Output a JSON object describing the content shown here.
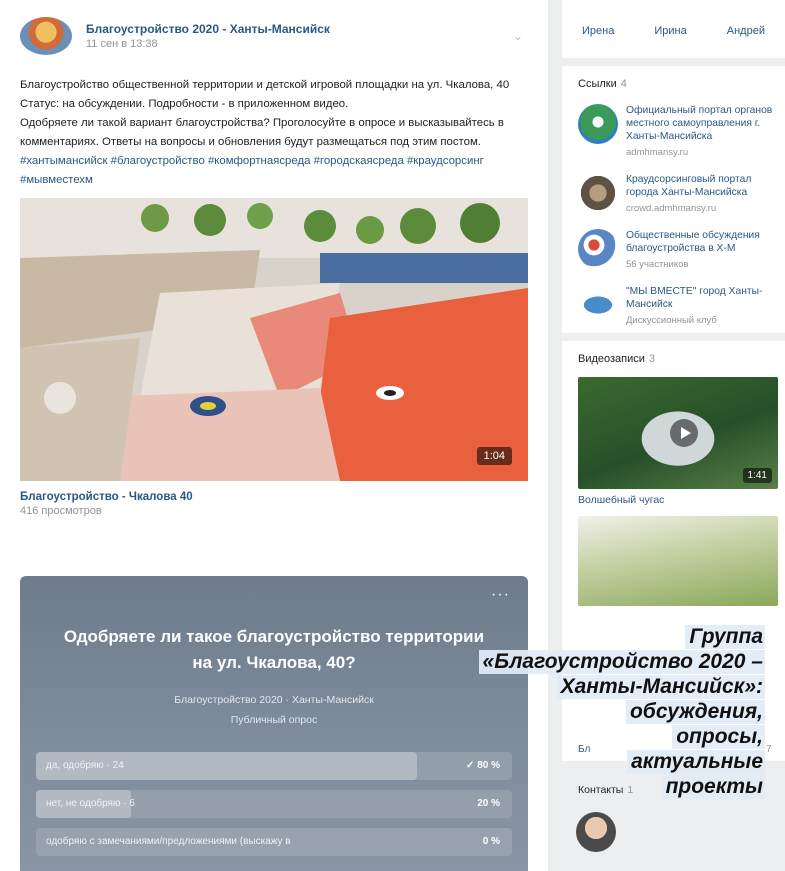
{
  "post": {
    "group_name": "Благоустройство 2020 - Ханты-Мансийск",
    "date": "11 сен в 13:38",
    "text_lines": [
      "Благоустройство общественной территории и детской игровой площадки на ул. Чкалова, 40",
      "Статус: на обсуждении. Подробности - в приложенном видео.",
      "Одобряете ли такой вариант благоустройства? Проголосуйте в опросе и высказывайтесь в комментариях. Ответы на вопросы и обновления будут размещаться под этим постом."
    ],
    "hashtags": "#хантымансийск #благоустройство #комфортнаясреда #городскаясреда #краудсорсинг #мывместехм",
    "video": {
      "duration": "1:04",
      "title": "Благоустройство - Чкалова 40",
      "views": "416 просмотров"
    },
    "poll": {
      "more": "···",
      "question": "Одобряете ли такое благоустройство территории на ул. Чкалова, 40?",
      "author": "Благоустройство 2020 · Ханты-Мансийск",
      "type": "Публичный опрос",
      "options": [
        {
          "label": "да, одобряю · 24",
          "percent": "80 %",
          "fraction": 0.8,
          "voted": true,
          "check": "✓"
        },
        {
          "label": "нет, не одобряю · 6",
          "percent": "20 %",
          "fraction": 0.2,
          "voted": false,
          "check": ""
        },
        {
          "label": "одобряю с замечаниями/предложениями (выскажу в",
          "percent": "0 %",
          "fraction": 0.0,
          "voted": false,
          "check": ""
        }
      ]
    }
  },
  "sidebar": {
    "friends": [
      "Ирена",
      "Ирина",
      "Андрей"
    ],
    "links": {
      "header": "Ссылки",
      "count": "4",
      "items": [
        {
          "title": "Официальный портал органов местного самоуправления г. Ханты-Мансийска",
          "sub": "admhmansy.ru",
          "color": "#3a9a5a"
        },
        {
          "title": "Краудсорсинговый портал города Ханты-Мансийска",
          "sub": "crowd.admhmansy.ru",
          "color": "#7a6a55"
        },
        {
          "title": "Общественные обсуждения благоустройства в Х-М",
          "sub": "56 участников",
          "color": "#5b86c4"
        },
        {
          "title": "\"МЫ ВМЕСТЕ\" город Ханты-Мансийск",
          "sub": "Дискуссионный клуб",
          "color": "#4a8cc8"
        }
      ]
    },
    "videos": {
      "header": "Видеозаписи",
      "count": "3",
      "items": [
        {
          "duration": "1:41",
          "name": "Волшебный чугас"
        },
        {
          "name_suffix": "Бл",
          "num": "7"
        }
      ]
    },
    "contacts": {
      "header": "Контакты",
      "count": "1"
    }
  },
  "caption": {
    "lines": [
      "Группа",
      "«Благоустройство 2020 –",
      "Ханты-Мансийск»:",
      "обсуждения,",
      "опросы,",
      "актуальные",
      "проекты"
    ]
  },
  "colors": {
    "link": "#2a5885",
    "muted": "#939393",
    "poll_bg": "#7a8797",
    "caption_bg": "#e1ecf7"
  }
}
